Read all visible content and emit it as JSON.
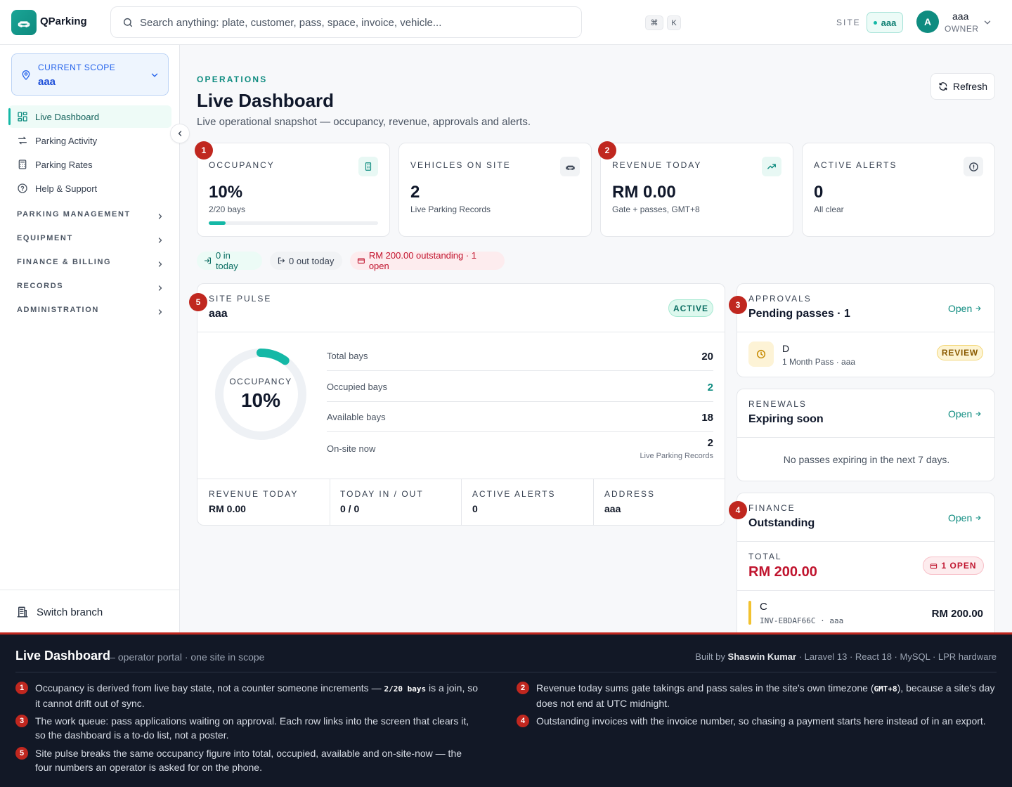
{
  "app": {
    "name": "QParking"
  },
  "search": {
    "placeholder": "Search anything: plate, customer, pass, space, invoice, vehicle...",
    "kbd_cmd": "⌘",
    "kbd_key": "K"
  },
  "topbar": {
    "site_label": "SITE",
    "site_value": "aaa",
    "user_initial": "A",
    "user_name": "aaa",
    "user_role": "OWNER"
  },
  "sidebar": {
    "scope_label": "CURRENT SCOPE",
    "scope_value": "aaa",
    "items": [
      {
        "label": "Live Dashboard",
        "icon": "grid-icon",
        "active": true
      },
      {
        "label": "Parking Activity",
        "icon": "arrows-icon"
      },
      {
        "label": "Parking Rates",
        "icon": "calculator-icon"
      },
      {
        "label": "Help & Support",
        "icon": "help-icon"
      }
    ],
    "sections": [
      "PARKING MANAGEMENT",
      "EQUIPMENT",
      "FINANCE & BILLING",
      "RECORDS",
      "ADMINISTRATION"
    ],
    "switch_branch": "Switch branch"
  },
  "page": {
    "eyebrow": "OPERATIONS",
    "title": "Live Dashboard",
    "subtitle": "Live operational snapshot — occupancy, revenue, approvals and alerts.",
    "refresh": "Refresh"
  },
  "kpis": [
    {
      "label": "OCCUPANCY",
      "value": "10%",
      "sub": "2/20 bays",
      "progress": 0.1,
      "icon": "building-icon"
    },
    {
      "label": "VEHICLES ON SITE",
      "value": "2",
      "sub": "Live Parking Records",
      "icon": "car-icon"
    },
    {
      "label": "REVENUE TODAY",
      "value": "RM 0.00",
      "sub": "Gate + passes, GMT+8",
      "icon": "trend-up-icon"
    },
    {
      "label": "ACTIVE ALERTS",
      "value": "0",
      "sub": "All clear",
      "icon": "alert-circle-icon"
    }
  ],
  "chips": {
    "in_today": "0 in today",
    "out_today": "0 out today",
    "outstanding": "RM 200.00 outstanding · 1 open"
  },
  "site_pulse": {
    "eyebrow": "SITE PULSE",
    "name": "aaa",
    "status": "ACTIVE",
    "ring_label": "OCCUPANCY",
    "ring_value": "10%",
    "ring_fraction": 0.1,
    "stats": [
      {
        "label": "Total bays",
        "value": "20"
      },
      {
        "label": "Occupied bays",
        "value": "2"
      },
      {
        "label": "Available bays",
        "value": "18"
      },
      {
        "label": "On-site now",
        "value": "2",
        "note": "Live Parking Records"
      }
    ],
    "footer": [
      {
        "label": "REVENUE TODAY",
        "value": "RM 0.00"
      },
      {
        "label": "TODAY IN / OUT",
        "value": "0 / 0"
      },
      {
        "label": "ACTIVE ALERTS",
        "value": "0"
      },
      {
        "label": "ADDRESS",
        "value": "aaa"
      }
    ]
  },
  "approvals": {
    "eyebrow": "APPROVALS",
    "title": "Pending passes · 1",
    "open": "Open",
    "item": {
      "name": "D",
      "detail": "1 Month Pass · aaa",
      "status": "REVIEW"
    }
  },
  "renewals": {
    "eyebrow": "RENEWALS",
    "title": "Expiring soon",
    "open": "Open",
    "empty": "No passes expiring in the next 7 days."
  },
  "finance": {
    "eyebrow": "FINANCE",
    "title": "Outstanding",
    "open": "Open",
    "total_label": "TOTAL",
    "total_value": "RM 200.00",
    "open_count": "1 OPEN",
    "item": {
      "name": "C",
      "invoice": "INV-EBDAF66C · aaa",
      "amount": "RM 200.00"
    }
  },
  "annotation_numbers": [
    "1",
    "2",
    "3",
    "4",
    "5"
  ],
  "footer_panel": {
    "title": "Live Dashboard",
    "subtitle": "— operator portal · one site in scope",
    "credit_prefix": "Built by",
    "credit_name": "Shaswin Kumar",
    "credit_suffix": "· Laravel 13 · React 18 · MySQL · LPR hardware",
    "notes": [
      {
        "num": "1",
        "pre": "Occupancy is derived from live bay state, not a counter someone increments —",
        "code": "2/20 bays",
        "post": "is a join, so it cannot drift out of sync."
      },
      {
        "num": "2",
        "pre": "Revenue today sums gate takings and pass sales in the site's own timezone (",
        "code": "GMT+8",
        "post": "), because a site's day does not end at UTC midnight."
      },
      {
        "num": "3",
        "text": "The work queue: pass applications waiting on approval. Each row links into the screen that clears it, so the dashboard is a to-do list, not a poster."
      },
      {
        "num": "4",
        "text": "Outstanding invoices with the invoice number, so chasing a payment starts here instead of in an export."
      },
      {
        "num": "5",
        "text": "Site pulse breaks the same occupancy figure into total, occupied, available and on-site-now — the four numbers an operator is asked for on the phone."
      }
    ]
  },
  "colors": {
    "accent": "#14b8a6",
    "accent_dark": "#0f8c80",
    "danger": "#c0142e",
    "annotation": "#c0271f"
  }
}
